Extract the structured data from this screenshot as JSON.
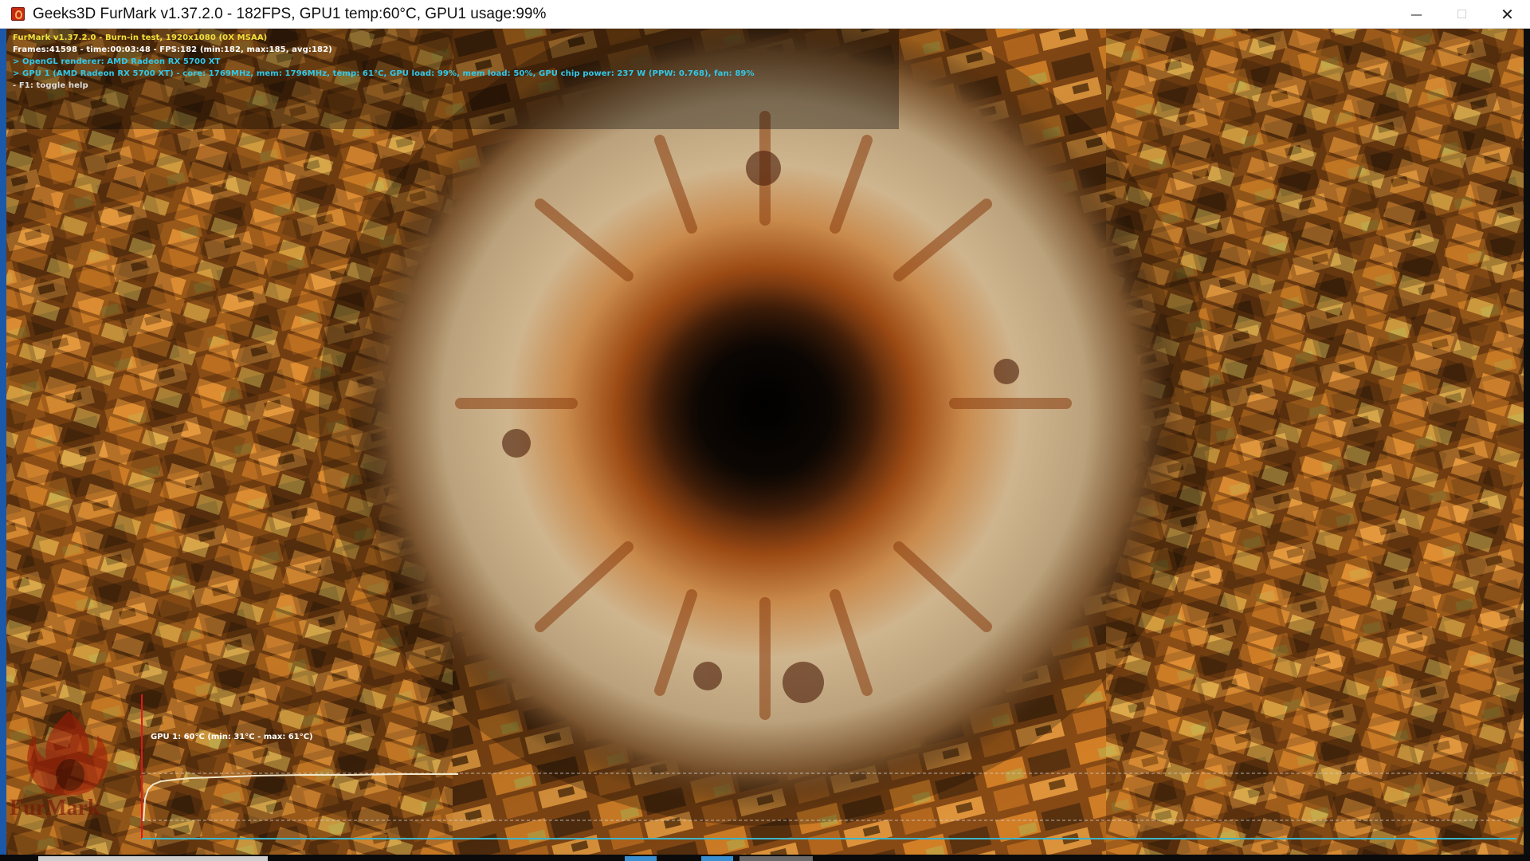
{
  "window": {
    "title": "Geeks3D FurMark v1.37.2.0 - 182FPS, GPU1 temp:60°C, GPU1 usage:99%",
    "icon": "furmark-app-icon",
    "controls": {
      "minimize": "—",
      "maximize": "☐",
      "close": "✕"
    }
  },
  "hud": {
    "line1": "FurMark v1.37.2.0 - Burn-in test, 1920x1080 (0X MSAA)",
    "line2": "Frames:41598 - time:00:03:48 - FPS:182 (min:182, max:185, avg:182)",
    "line3": "> OpenGL renderer: AMD Radeon RX 5700 XT",
    "line4": "> GPU 1 (AMD Radeon RX 5700 XT) - core: 1769MHz, mem: 1796MHz, temp: 61°C, GPU load: 99%, mem load: 50%, GPU chip power: 237 W (PPW: 0.768), fan: 89%",
    "line5": "- F1: toggle help"
  },
  "graph": {
    "label": "GPU 1: 60°C (min: 31°C - max: 61°C)",
    "colors": {
      "curve": "#f2e6c8",
      "axis": "#3fb4c8",
      "marker": "#e01818"
    }
  },
  "logo": {
    "text": "FurMark"
  },
  "colors": {
    "yellow": "#f3e13a",
    "cyan": "#31c9ea",
    "accent": "#c62b12"
  }
}
